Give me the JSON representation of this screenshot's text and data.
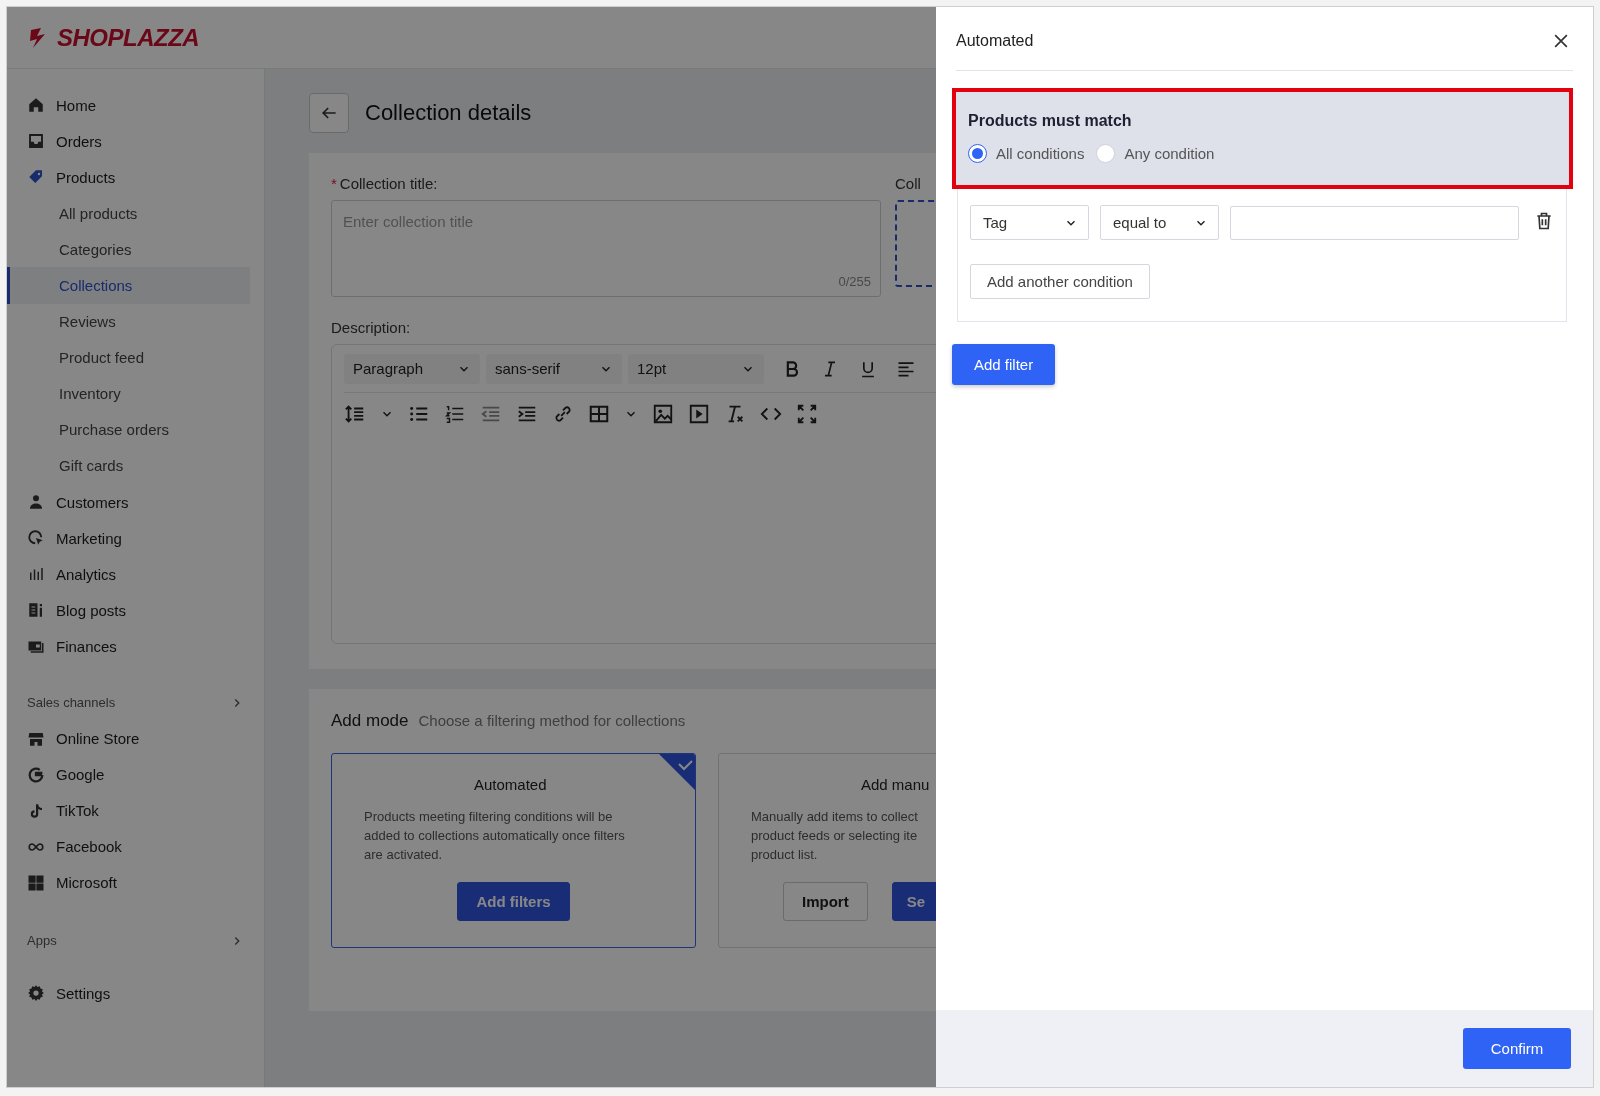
{
  "logo": {
    "text": "SHOPLAZZA"
  },
  "sidebar": {
    "groups": [
      {
        "items": [
          {
            "label": "Home",
            "selected": false
          },
          {
            "label": "Orders",
            "selected": false
          },
          {
            "label": "Products",
            "selected": true,
            "children": [
              {
                "label": "All products",
                "selected": false
              },
              {
                "label": "Categories",
                "selected": false
              },
              {
                "label": "Collections",
                "selected": true
              },
              {
                "label": "Reviews",
                "selected": false
              },
              {
                "label": "Product feed",
                "selected": false
              },
              {
                "label": "Inventory",
                "selected": false
              },
              {
                "label": "Purchase orders",
                "selected": false
              },
              {
                "label": "Gift cards",
                "selected": false
              }
            ]
          },
          {
            "label": "Customers",
            "selected": false
          },
          {
            "label": "Marketing",
            "selected": false
          },
          {
            "label": "Analytics",
            "selected": false
          },
          {
            "label": "Blog posts",
            "selected": false
          },
          {
            "label": "Finances",
            "selected": false
          }
        ]
      },
      {
        "heading": "Sales channels",
        "items": [
          {
            "label": "Online Store",
            "selected": false
          },
          {
            "label": "Google",
            "selected": false
          },
          {
            "label": "TikTok",
            "selected": false
          },
          {
            "label": "Facebook",
            "selected": false
          },
          {
            "label": "Microsoft",
            "selected": false
          }
        ]
      },
      {
        "heading": "Apps"
      },
      {
        "items": [
          {
            "label": "Settings",
            "selected": false
          }
        ]
      }
    ]
  },
  "page": {
    "title": "Collection details",
    "title_field": {
      "label": "Collection title:",
      "required_mark": "*",
      "placeholder": "Enter collection title",
      "counter": "0/255"
    },
    "image_label": "Coll",
    "description": {
      "label": "Description:",
      "selects": [
        {
          "value": "Paragraph"
        },
        {
          "value": "sans-serif"
        },
        {
          "value": "12pt"
        }
      ]
    },
    "add_mode": {
      "title": "Add mode",
      "subtitle": "Choose a filtering method for collections",
      "cards": [
        {
          "title": "Automated",
          "selected": true,
          "lines": [
            "Products meeting filtering conditions will be",
            "added to collections automatically once filters",
            "are activated."
          ],
          "buttons": [
            {
              "label": "Add filters",
              "kind": "primary"
            }
          ]
        },
        {
          "title": "Add manu",
          "selected": false,
          "lines": [
            "Manually add items to collect",
            "product feeds or selecting ite",
            "product list."
          ],
          "buttons": [
            {
              "label": "Import",
              "kind": "default"
            },
            {
              "label": "Se",
              "kind": "primary"
            }
          ]
        }
      ]
    }
  },
  "panel": {
    "title": "Automated",
    "match": {
      "label": "Products must match",
      "highlighted": true,
      "options": [
        {
          "label": "All conditions",
          "selected": true
        },
        {
          "label": "Any condition",
          "selected": false
        }
      ]
    },
    "conditions": [
      {
        "field": "Tag",
        "operator": "equal to"
      }
    ],
    "add_condition": "Add another condition",
    "add_filter": "Add filter",
    "confirm": "Confirm"
  }
}
